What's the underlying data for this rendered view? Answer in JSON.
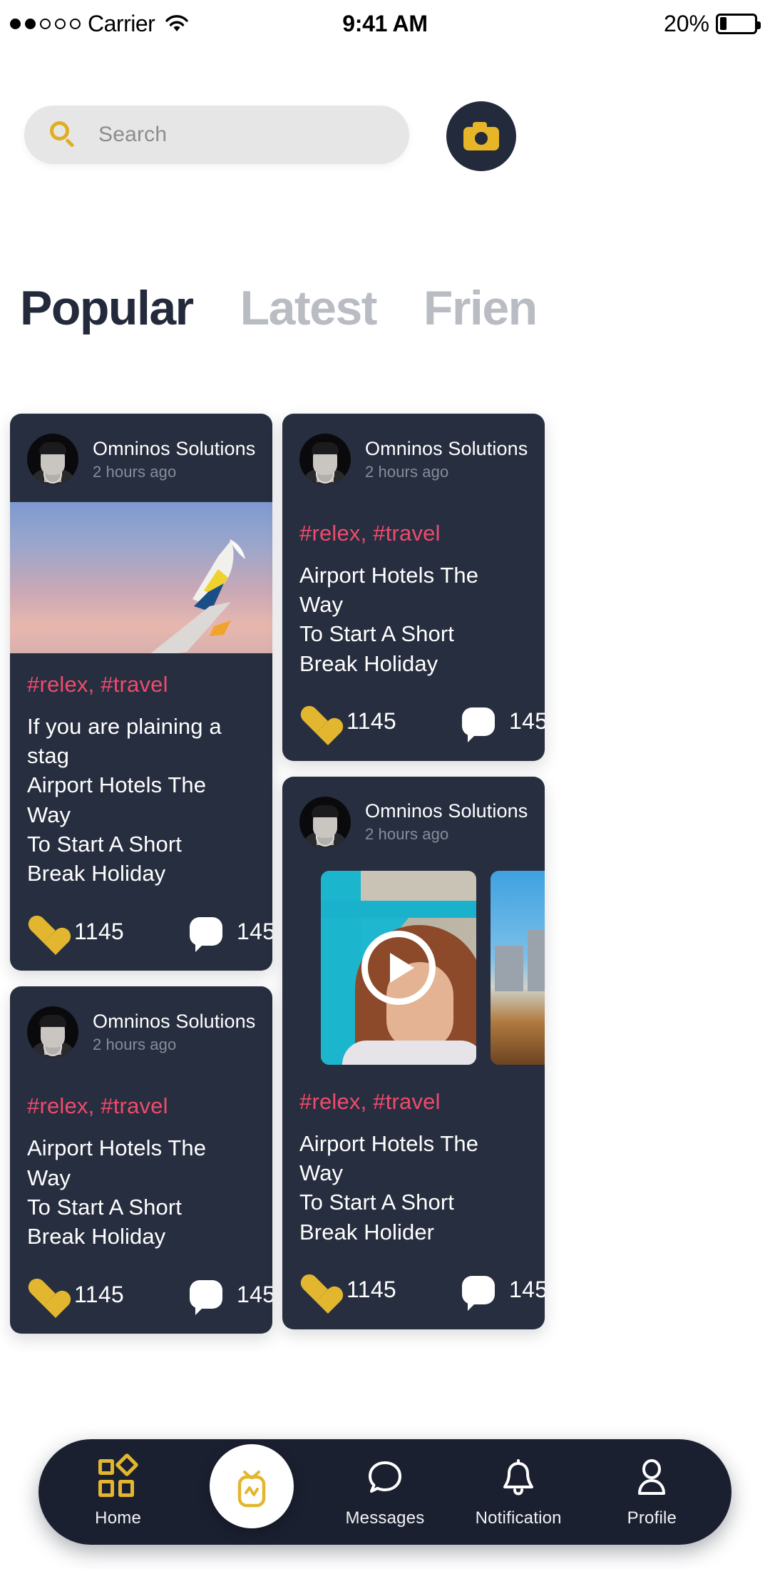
{
  "status_bar": {
    "signal_dots_filled": 2,
    "signal_dots_total": 5,
    "carrier": "Carrier",
    "wifi_icon": "wifi-icon",
    "time": "9:41 AM",
    "battery_percent": "20%",
    "battery_level": 20
  },
  "search": {
    "placeholder": "Search",
    "value": "",
    "icon": "search-icon",
    "camera_button_icon": "camera-icon"
  },
  "tabs": [
    {
      "label": "Popular",
      "active": true
    },
    {
      "label": "Latest",
      "active": false
    },
    {
      "label": "Frien",
      "active": false
    }
  ],
  "colors": {
    "card_bg": "#272e3f",
    "accent_gold": "#e3b62f",
    "tag_pink": "#ef4b6c",
    "dark_navy": "#232a3b",
    "nav_bg": "#1b2031"
  },
  "feed": {
    "left_column": [
      {
        "author": "Omninos Solutions",
        "time_ago": "2 hours ago",
        "media": "airplane-wing-sunset-photo",
        "tags": "#relex, #travel",
        "title": "If you are plaining a stag\nAirport Hotels The Way\nTo Start A Short\nBreak Holiday",
        "likes": "1145",
        "comments": "145"
      },
      {
        "author": "Omninos Solutions",
        "time_ago": "2 hours ago",
        "tags": "#relex, #travel",
        "title": "Airport Hotels The Way\nTo Start A Short\nBreak Holiday",
        "likes": "1145",
        "comments": "145"
      }
    ],
    "right_column": [
      {
        "author": "Omninos Solutions",
        "time_ago": "2 hours ago",
        "tags": "#relex, #travel",
        "title": "Airport Hotels The Way\nTo Start A Short\nBreak Holiday",
        "likes": "1145",
        "comments": "145"
      },
      {
        "author": "Omninos Solutions",
        "time_ago": "2 hours ago",
        "media": "video-carousel",
        "videos": [
          {
            "thumb": "woman-teal-wall-video",
            "has_play": true
          },
          {
            "thumb": "city-rooftop-video",
            "has_play": false
          }
        ],
        "tags": "#relex, #travel",
        "title": "Airport Hotels The Way\nTo Start A Short\nBreak Holider",
        "likes": "1145",
        "comments": "145"
      }
    ]
  },
  "bottom_nav": [
    {
      "label": "Home",
      "icon": "grid-home-icon",
      "active": true
    },
    {
      "label": "",
      "icon": "tv-video-icon",
      "fab": true
    },
    {
      "label": "Messages",
      "icon": "chat-bubble-icon",
      "active": false
    },
    {
      "label": "Notification",
      "icon": "bell-icon",
      "active": false
    },
    {
      "label": "Profile",
      "icon": "person-icon",
      "active": false
    }
  ]
}
